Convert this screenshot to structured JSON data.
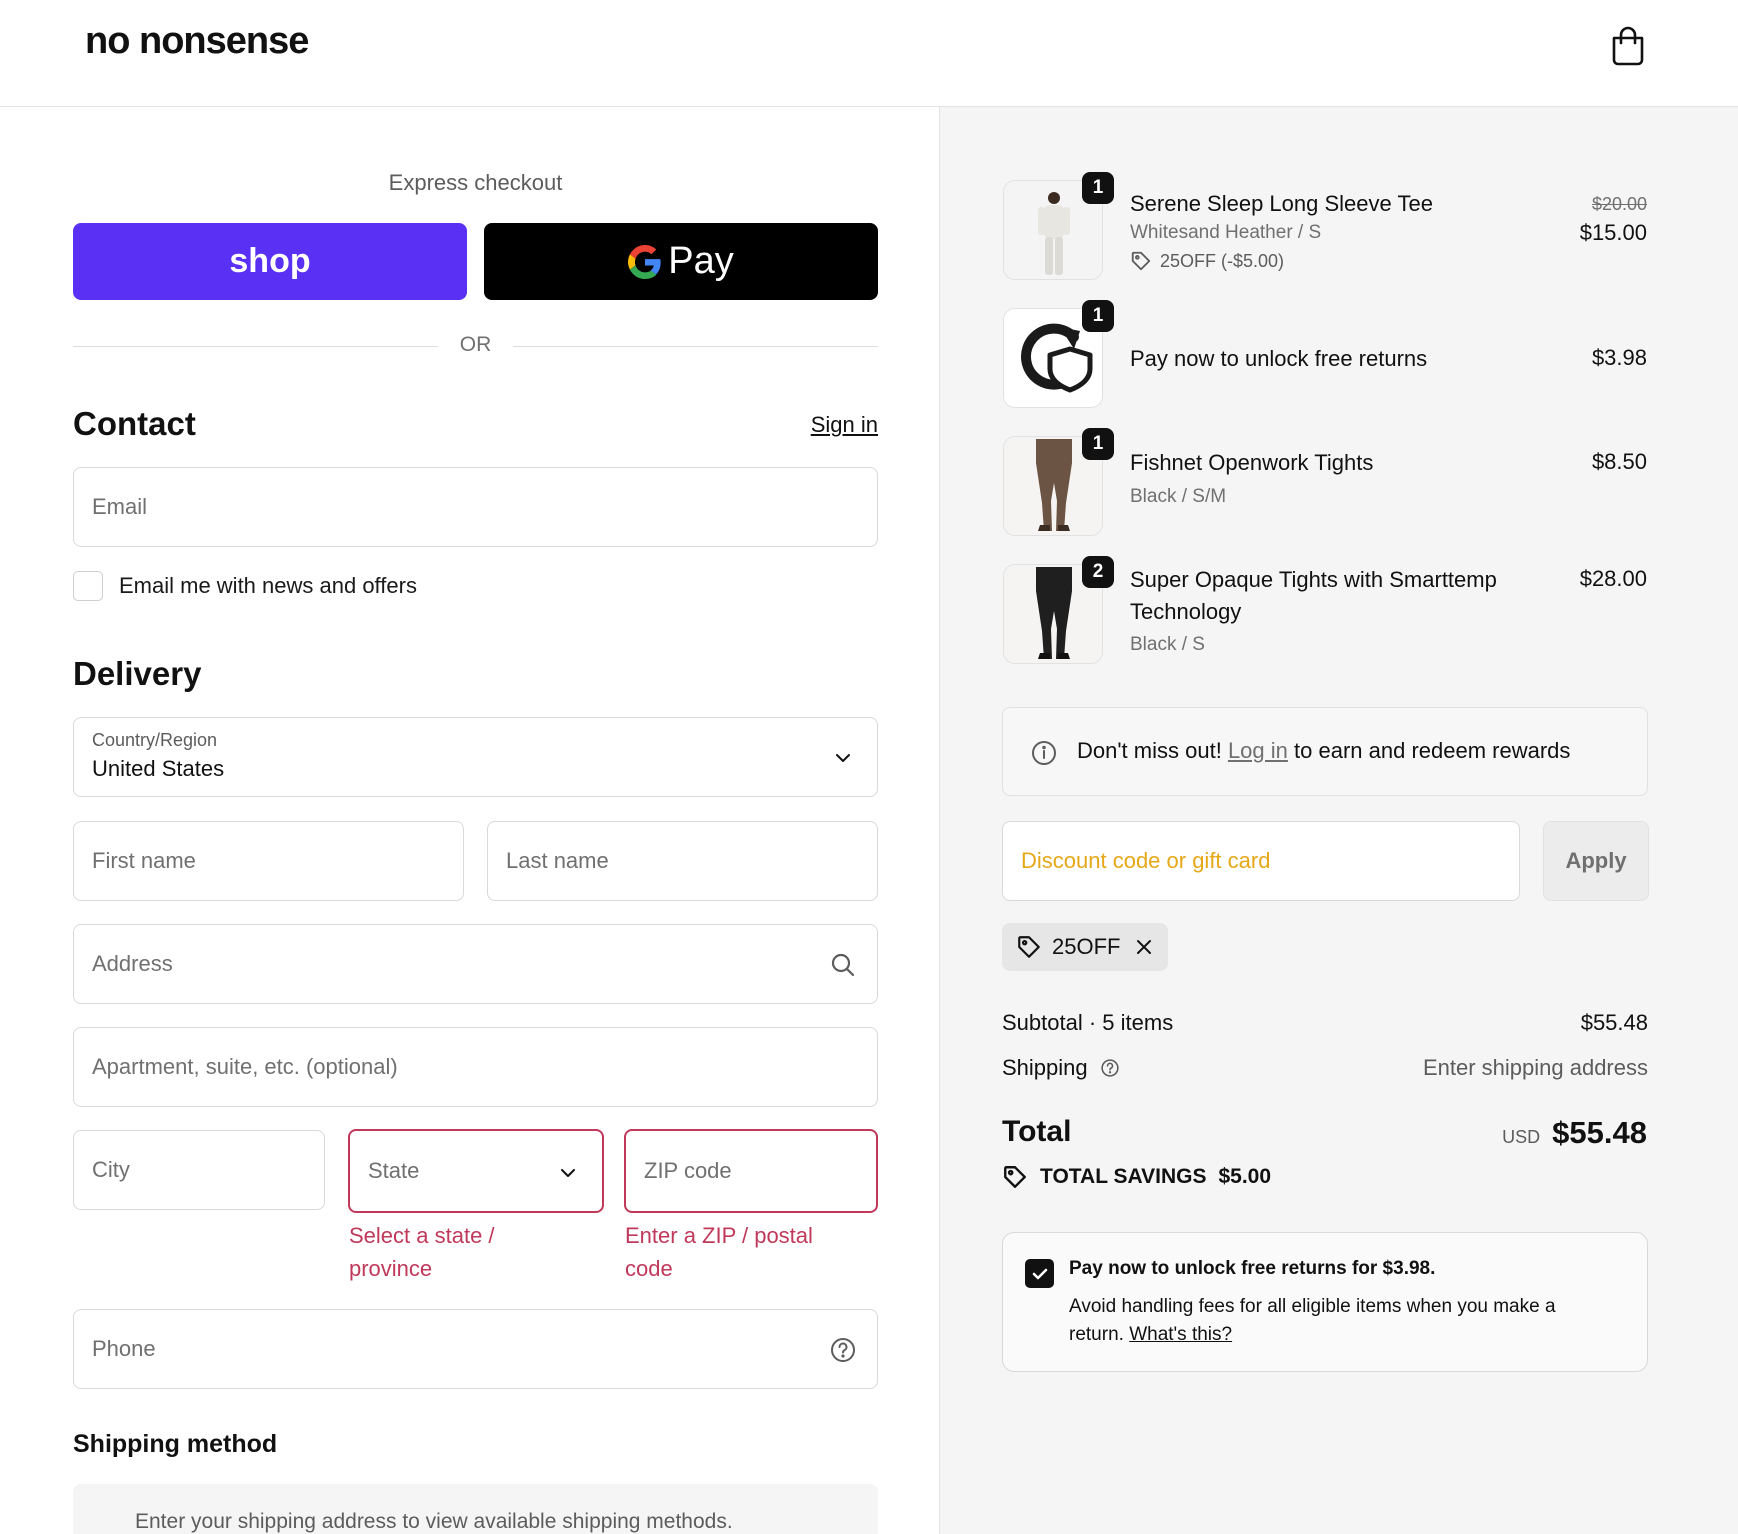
{
  "header": {
    "logo": "no nonsense",
    "cart_icon": "shopping-bag-icon"
  },
  "express": {
    "title": "Express checkout",
    "shop_label": "shop",
    "gpay_label": "Pay",
    "or_label": "OR"
  },
  "contact": {
    "title": "Contact",
    "signin_label": "Sign in",
    "email_placeholder": "Email",
    "newsletter_label": "Email me with news and offers"
  },
  "delivery": {
    "title": "Delivery",
    "country_label": "Country/Region",
    "country_value": "United States",
    "first_name_placeholder": "First name",
    "last_name_placeholder": "Last name",
    "address_placeholder": "Address",
    "apartment_placeholder": "Apartment, suite, etc. (optional)",
    "city_placeholder": "City",
    "state_placeholder": "State",
    "zip_placeholder": "ZIP code",
    "state_error": "Select a state / province",
    "zip_error": "Enter a ZIP / postal code",
    "phone_placeholder": "Phone"
  },
  "shipping_method": {
    "title": "Shipping method",
    "notice": "Enter your shipping address to view available shipping methods."
  },
  "order": {
    "items": [
      {
        "qty": "1",
        "name": "Serene Sleep Long Sleeve Tee",
        "variant": "Whitesand Heather / S",
        "discount": "25OFF (-$5.00)",
        "original_price": "$20.00",
        "price": "$15.00"
      },
      {
        "qty": "1",
        "name": "Pay now to unlock free returns",
        "price": "$3.98"
      },
      {
        "qty": "1",
        "name": "Fishnet Openwork Tights",
        "variant": "Black / S/M",
        "price": "$8.50"
      },
      {
        "qty": "2",
        "name_line1": "Super Opaque Tights with Smarttemp",
        "name_line2": "Technology",
        "variant": "Black / S",
        "price": "$28.00"
      }
    ],
    "rewards_prefix": "Don't miss out!",
    "rewards_link": "Log in",
    "rewards_suffix": "to earn and redeem rewards",
    "discount_placeholder": "Discount code or gift card",
    "apply_label": "Apply",
    "applied_code": "25OFF",
    "subtotal_label": "Subtotal · 5 items",
    "subtotal_value": "$55.48",
    "shipping_label": "Shipping",
    "shipping_value": "Enter shipping address",
    "total_label": "Total",
    "currency": "USD",
    "total_value": "$55.48",
    "savings_label": "TOTAL SAVINGS",
    "savings_value": "$5.00",
    "returns_title": "Pay now to unlock free returns for $3.98.",
    "returns_body": "Avoid handling fees for all eligible items when you make a return.",
    "returns_link": "What's this?"
  },
  "colors": {
    "shop_purple": "#5a31f4",
    "error": "#c0395a",
    "discount_placeholder": "#e6a817"
  }
}
